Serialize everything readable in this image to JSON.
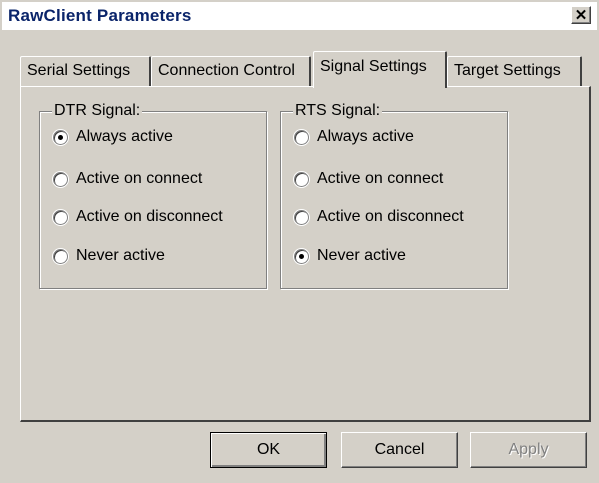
{
  "window": {
    "title": "RawClient Parameters",
    "close_glyph": "✕"
  },
  "tabs": [
    {
      "label": "Serial Settings",
      "active": false
    },
    {
      "label": "Connection Control",
      "active": false
    },
    {
      "label": "Signal Settings",
      "active": true
    },
    {
      "label": "Target Settings",
      "active": false
    }
  ],
  "dtr_group": {
    "label": "DTR Signal:",
    "options": [
      {
        "label": "Always active",
        "checked": true
      },
      {
        "label": "Active on connect",
        "checked": false
      },
      {
        "label": "Active on disconnect",
        "checked": false
      },
      {
        "label": "Never active",
        "checked": false
      }
    ]
  },
  "rts_group": {
    "label": "RTS Signal:",
    "options": [
      {
        "label": "Always active",
        "checked": false
      },
      {
        "label": "Active on connect",
        "checked": false
      },
      {
        "label": "Active on disconnect",
        "checked": false
      },
      {
        "label": "Never active",
        "checked": true
      }
    ]
  },
  "buttons": {
    "ok": "OK",
    "cancel": "Cancel",
    "apply": "Apply"
  },
  "colors": {
    "face": "#d4d0c8",
    "title_text": "#0a246a",
    "disabled_text": "#808080"
  }
}
